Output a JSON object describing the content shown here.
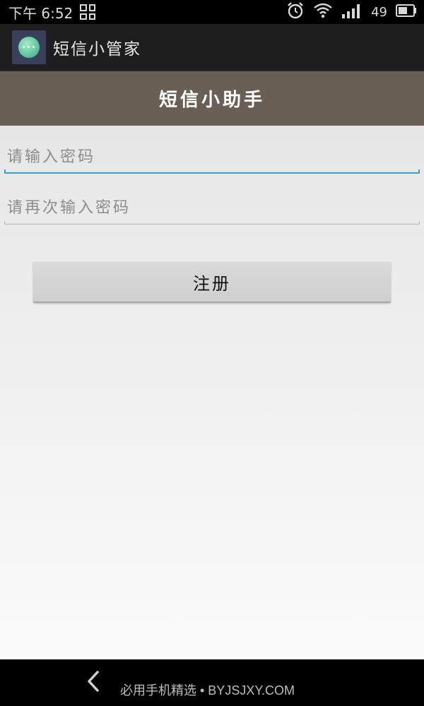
{
  "status_bar": {
    "time": "下午 6:52",
    "battery_level": "49",
    "icons": [
      "grid-icon",
      "alarm-icon",
      "wifi-icon",
      "signal-icon",
      "battery-icon"
    ]
  },
  "action_bar": {
    "app_title": "短信小管家",
    "app_icon": "chat-bubble-icon",
    "app_icon_glyph": "•••"
  },
  "header": {
    "title": "短信小助手",
    "background_color": "#695f55"
  },
  "form": {
    "password_placeholder": "请输入密码",
    "password_value": "",
    "confirm_placeholder": "请再次输入密码",
    "confirm_value": "",
    "register_label": "注册",
    "focus_color": "#33a9cf"
  },
  "nav_bar": {
    "back_icon": "chevron-left-icon",
    "watermark": "必用手机精选 • BYJSJXY.COM"
  }
}
